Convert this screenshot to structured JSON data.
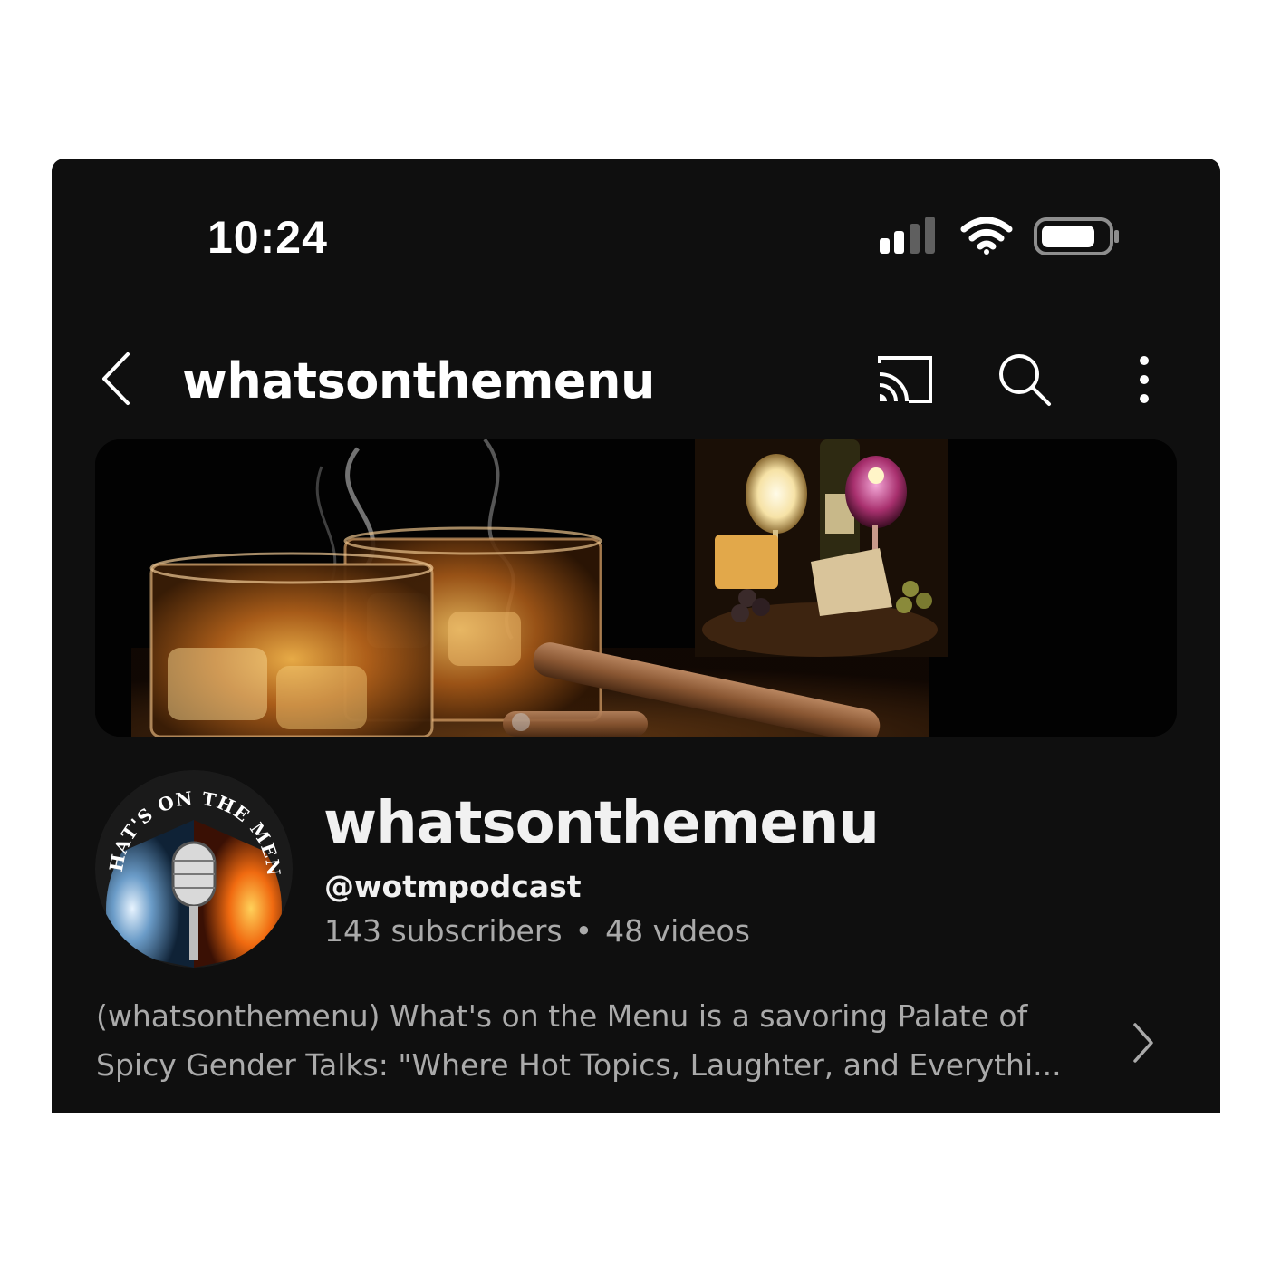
{
  "status_bar": {
    "time": "10:24",
    "signal_icon": "cellular-signal-icon",
    "wifi_icon": "wifi-icon",
    "battery_icon": "battery-icon"
  },
  "app_bar": {
    "title": "whatsonthemenu",
    "back_icon": "back-chevron-icon",
    "actions": [
      "cast-icon",
      "search-icon",
      "more-vertical-icon"
    ]
  },
  "channel": {
    "name": "whatsonthemenu",
    "handle": "@wotmpodcast",
    "subscribers": "143 subscribers",
    "separator": "•",
    "videos": "48 videos",
    "avatar_text": "WHAT'S ON THE MENU",
    "description_line1": "(whatsonthemenu) What's on the Menu is a savoring Palate of",
    "description_line2": "Spicy Gender Talks: \"Where Hot Topics, Laughter, and Everythi...",
    "description_more_icon": "chevron-right-icon"
  },
  "colors": {
    "background": "#0f0f0f",
    "primary_text": "#f1f1f1",
    "secondary_text": "#aaaaaa",
    "page_outside": "#ffffff"
  }
}
